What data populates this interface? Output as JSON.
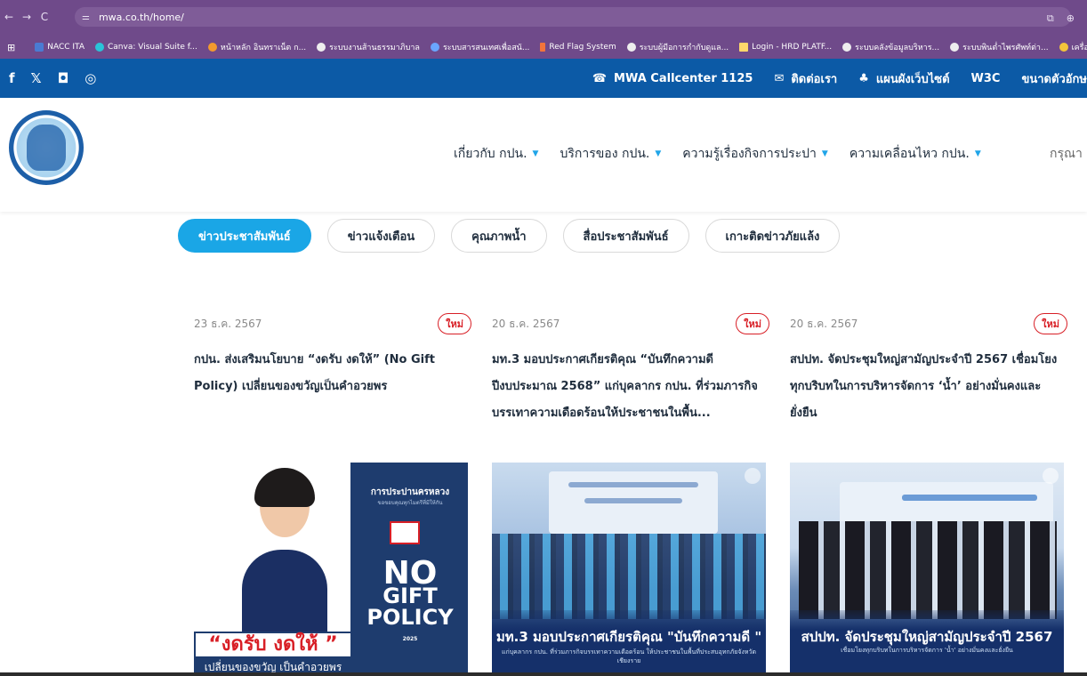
{
  "browser": {
    "url": "mwa.co.th/home/",
    "bookmarks": [
      {
        "label": "NACC ITA",
        "icon": "nacc"
      },
      {
        "label": "Canva: Visual Suite f...",
        "icon": "canva"
      },
      {
        "label": "หน้าหลัก อินทราเน็ต ก...",
        "icon": "orange"
      },
      {
        "label": "ระบบงานส้านธรรมาภิบาล",
        "icon": "gray"
      },
      {
        "label": "ระบบสารสนเทศเพื่อสนั...",
        "icon": "blue"
      },
      {
        "label": "Red Flag System",
        "icon": "flag"
      },
      {
        "label": "ระบบผู้มีอการกำกับดูแล...",
        "icon": "gray"
      },
      {
        "label": "Login - HRD PLATF...",
        "icon": "bar"
      },
      {
        "label": "ระบบคลังข้อมูลบริหาร...",
        "icon": "gray"
      },
      {
        "label": "ระบบพินต่ำไพรศัพท์ต่า...",
        "icon": "gray"
      },
      {
        "label": "เครื่องมือแปลงข้อควา",
        "icon": "yellow"
      }
    ]
  },
  "topbar": {
    "social": [
      "f",
      "𝕏",
      "◘",
      "◎"
    ],
    "links": [
      {
        "icon": "☎",
        "label": "MWA Callcenter 1125"
      },
      {
        "icon": "✉",
        "label": "ติดต่อเรา"
      },
      {
        "icon": "♣",
        "label": "แผนผังเว็บไซต์"
      },
      {
        "icon": "",
        "label": "W3C"
      },
      {
        "icon": "",
        "label": "ขนาดตัวอักษ"
      }
    ]
  },
  "nav": {
    "items": [
      "เกี่ยวกับ กปน.",
      "บริการของ กปน.",
      "ความรู้เรื่องกิจการประปา",
      "ความเคลื่อนไหว กปน."
    ],
    "search_text": "กรุณา"
  },
  "tabs": [
    {
      "label": "ข่าวประชาสัมพันธ์",
      "active": true
    },
    {
      "label": "ข่าวแจ้งเตือน",
      "active": false
    },
    {
      "label": "คุณภาพน้ำ",
      "active": false
    },
    {
      "label": "สื่อประชาสัมพันธ์",
      "active": false
    },
    {
      "label": "เกาะติดข่าวภัยแล้ง",
      "active": false
    }
  ],
  "news": [
    {
      "date": "23 ธ.ค. 2567",
      "badge": "ใหม่",
      "title": "กปน. ส่งเสริมนโยบาย “งดรับ งดให้” (No Gift Policy) เปลี่ยนของขวัญเป็นคำอวยพร",
      "image": {
        "ng_title": "การประปานครหลวง",
        "ng_sub": "ขอขอบคุณทุกไมตรีที่มีให้กัน",
        "ng_no": "NO",
        "ng_gift": "GIFT",
        "ng_policy": "POLICY",
        "ng_year": "2025",
        "slogan": "“งดรับ งดให้ ”",
        "slogan2": "เปลี่ยนของขวัญ เป็นคำอวยพร"
      }
    },
    {
      "date": "20 ธ.ค. 2567",
      "badge": "ใหม่",
      "title": "มท.3 มอบประกาศเกียรติคุณ “บันทึกความดี ปีงบประมาณ 2568” แก่บุคลากร กปน. ที่ร่วมภารกิจบรรเทาความเดือดร้อนให้ประชาชนในพื้น...",
      "image": {
        "cap_main": "มท.3 มอบประกาศเกียรติคุณ \"บันทึกความดี \"",
        "cap_sub": "แก่บุคลากร กปน. ที่ร่วมภารกิจบรรเทาความเดือดร้อน ให้ประชาชนในพื้นที่ประสบอุทกภัยจังหวัดเชียงราย"
      }
    },
    {
      "date": "20 ธ.ค. 2567",
      "badge": "ใหม่",
      "title": "สปปท. จัดประชุมใหญ่สามัญประจำปี 2567 เชื่อมโยงทุกบริบทในการบริหารจัดการ ‘น้ำ’ อย่างมั่นคงและยั่งยืน",
      "image": {
        "cap_main": "สปปท. จัดประชุมใหญ่สามัญประจำปี 2567",
        "cap_sub": "เชื่อมโยงทุกบริบทในการบริหารจัดการ 'น้ำ' อย่างมั่นคงและยั่งยืน"
      }
    }
  ],
  "colors": {
    "browser_frame": "#6f4a8a",
    "topbar": "#0c5aa6",
    "accent": "#1aa6e6",
    "badge": "#d81f26"
  }
}
